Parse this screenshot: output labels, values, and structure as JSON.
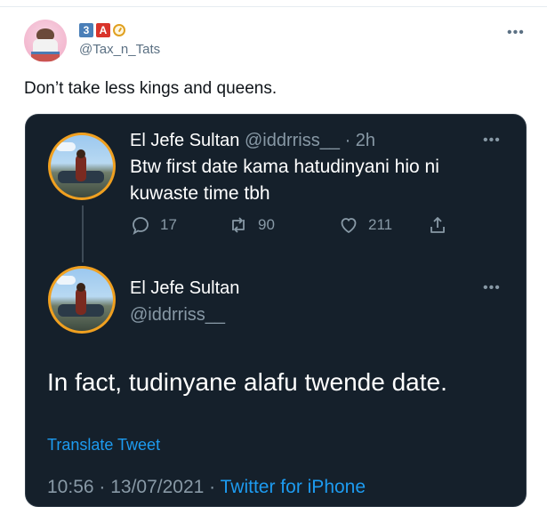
{
  "outer_tweet": {
    "badges": [
      "3",
      "A"
    ],
    "handle": "@Tax_n_Tats",
    "more": "•••",
    "text": "Don’t take less kings and queens."
  },
  "quoted": {
    "reply": {
      "name": "El Jefe Sultan",
      "handle": "@iddrriss__",
      "time": "· 2h",
      "more": "•••",
      "text_line1": "Btw first date kama hatudinyani hio ni",
      "text_line2": "kuwaste time tbh",
      "replies": "17",
      "retweets": "90",
      "likes": "211"
    },
    "main": {
      "name": "El Jefe Sultan",
      "handle": "@iddrriss__",
      "more": "•••",
      "text": "In fact, tudinyane alafu twende date.",
      "translate": "Translate Tweet",
      "timestamp": "10:56 · 13/07/2021 ·",
      "source": "Twitter for iPhone"
    }
  },
  "colors": {
    "card_bg": "#15202b",
    "accent": "#1d9bf0",
    "muted": "#8899a6"
  }
}
